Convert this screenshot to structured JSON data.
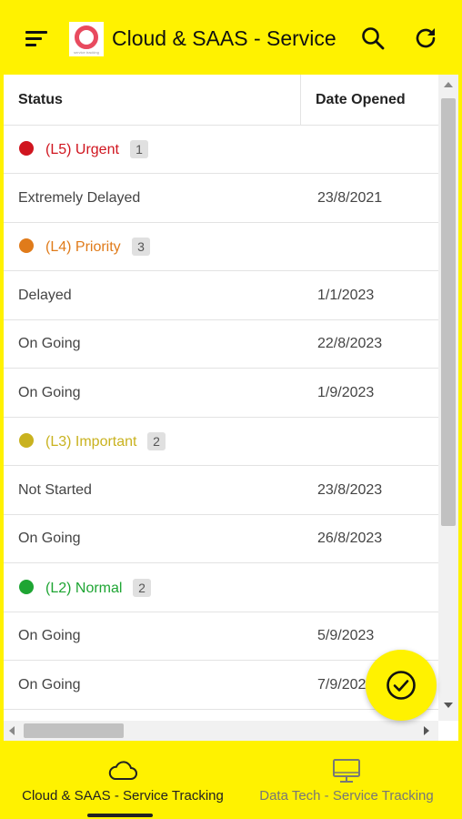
{
  "header": {
    "title": "Cloud & SAAS - Service",
    "logo_text": "service tracking"
  },
  "table": {
    "columns": [
      "Status",
      "Date Opened"
    ],
    "groups": [
      {
        "label": "(L5) Urgent",
        "count": "1",
        "color": "#d0151f",
        "rows": [
          {
            "status": "Extremely Delayed",
            "date": "23/8/2021"
          }
        ]
      },
      {
        "label": "(L4) Priority",
        "count": "3",
        "color": "#e07b1a",
        "rows": [
          {
            "status": "Delayed",
            "date": "1/1/2023"
          },
          {
            "status": "On Going",
            "date": "22/8/2023"
          },
          {
            "status": "On Going",
            "date": "1/9/2023"
          }
        ]
      },
      {
        "label": "(L3) Important",
        "count": "2",
        "color": "#c9b21f",
        "rows": [
          {
            "status": "Not Started",
            "date": "23/8/2023"
          },
          {
            "status": "On Going",
            "date": "26/8/2023"
          }
        ]
      },
      {
        "label": "(L2) Normal",
        "count": "2",
        "color": "#1ea533",
        "rows": [
          {
            "status": "On Going",
            "date": "5/9/2023"
          },
          {
            "status": "On Going",
            "date": "7/9/2023"
          }
        ]
      }
    ]
  },
  "bottom_nav": {
    "items": [
      {
        "label": "Cloud & SAAS - Service Tracking",
        "icon": "cloud-icon",
        "active": true
      },
      {
        "label": "Data Tech - Service Tracking",
        "icon": "monitor-icon",
        "active": false
      }
    ]
  },
  "colors": {
    "accent": "#fff200"
  }
}
